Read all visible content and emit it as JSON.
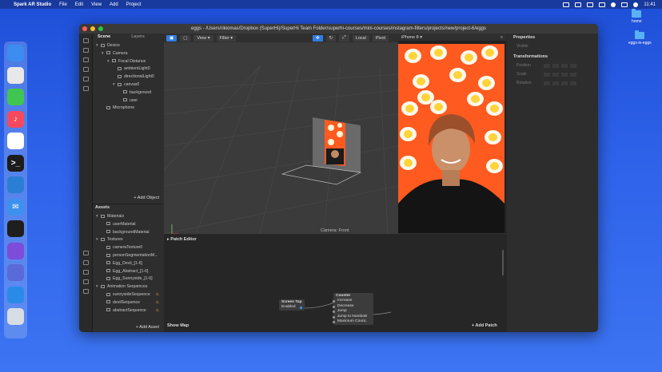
{
  "menubar": {
    "app_name": "Spark AR Studio",
    "menus": [
      "File",
      "Edit",
      "View",
      "Add",
      "Project"
    ],
    "clock": "11:41"
  },
  "desktop": {
    "icons": [
      {
        "label": "home"
      },
      {
        "label": "eggs-is-eggs"
      }
    ]
  },
  "dock": {
    "apps": [
      {
        "name": "finder-icon",
        "color": "#3b8df0",
        "glyph": ""
      },
      {
        "name": "chrome-icon",
        "color": "#e8e8e8",
        "glyph": ""
      },
      {
        "name": "messages-icon",
        "color": "#3fc552",
        "glyph": ""
      },
      {
        "name": "music-icon",
        "color": "#f54a5e",
        "glyph": "♪"
      },
      {
        "name": "slack-icon",
        "color": "#ffffff",
        "glyph": ""
      },
      {
        "name": "terminal-icon",
        "color": "#1c1c1c",
        "glyph": ">_"
      },
      {
        "name": "vscode-icon",
        "color": "#2a7fd4",
        "glyph": ""
      },
      {
        "name": "mail-icon",
        "color": "#3d90ee",
        "glyph": "✉"
      },
      {
        "name": "figma-icon",
        "color": "#1e1e1e",
        "glyph": ""
      },
      {
        "name": "sparkar-icon",
        "color": "#7d4cd8",
        "glyph": ""
      },
      {
        "name": "discord-icon",
        "color": "#5a6ad8",
        "glyph": ""
      },
      {
        "name": "tweetbot-icon",
        "color": "#2a8ae8",
        "glyph": ""
      },
      {
        "name": "trash-icon",
        "color": "#d8dde4",
        "glyph": ""
      }
    ]
  },
  "window": {
    "title": "eggs - /Users/rikiomas/Dropbox (SuperHi)/SuperHi Team Folder/superhi-courses/mini-courses/instagram-filters/projects/new/project-6/eggs"
  },
  "scene": {
    "tabs": [
      "Scene",
      "Layers"
    ],
    "items": [
      {
        "label": "Device",
        "indent": 0,
        "arrow": "▾"
      },
      {
        "label": "Camera",
        "indent": 1,
        "arrow": "▾"
      },
      {
        "label": "Focal Distance",
        "indent": 2,
        "arrow": "▾"
      },
      {
        "label": "ambientLight0",
        "indent": 3,
        "arrow": ""
      },
      {
        "label": "directionalLight0",
        "indent": 3,
        "arrow": ""
      },
      {
        "label": "canvas0",
        "indent": 3,
        "arrow": "▾"
      },
      {
        "label": "background",
        "indent": 4,
        "arrow": ""
      },
      {
        "label": "user",
        "indent": 4,
        "arrow": ""
      },
      {
        "label": "Microphone",
        "indent": 1,
        "arrow": ""
      }
    ],
    "add_object": "+ Add Object"
  },
  "assets": {
    "header": "Assets",
    "items": [
      {
        "label": "Materials",
        "indent": 0,
        "arrow": "▾",
        "warn": ""
      },
      {
        "label": "userMaterial",
        "indent": 1,
        "arrow": "",
        "warn": ""
      },
      {
        "label": "backgroundMaterial",
        "indent": 1,
        "arrow": "",
        "warn": ""
      },
      {
        "label": "Textures",
        "indent": 0,
        "arrow": "▾",
        "warn": ""
      },
      {
        "label": "cameraTexture0",
        "indent": 1,
        "arrow": "",
        "warn": ""
      },
      {
        "label": "personSegmentationM...",
        "indent": 1,
        "arrow": "",
        "warn": ""
      },
      {
        "label": "Egg_Devil_[1-6]",
        "indent": 1,
        "arrow": "",
        "warn": ""
      },
      {
        "label": "Egg_Abstract_[1-6]",
        "indent": 1,
        "arrow": "",
        "warn": ""
      },
      {
        "label": "Egg_Sunnyside_[1-6]",
        "indent": 1,
        "arrow": "",
        "warn": ""
      },
      {
        "label": "Animation Sequences",
        "indent": 0,
        "arrow": "▾",
        "warn": ""
      },
      {
        "label": "sunnysideSequence",
        "indent": 1,
        "arrow": "",
        "warn": "⚠"
      },
      {
        "label": "devilSequence",
        "indent": 1,
        "arrow": "",
        "warn": "⚠"
      },
      {
        "label": "abstractSequence",
        "indent": 1,
        "arrow": "",
        "warn": "⚠"
      }
    ],
    "add_asset": "+ Add Asset"
  },
  "viewport": {
    "tools": {
      "view": "View ▾",
      "filter": "Filter ▾",
      "local": "Local",
      "pivot": "Pivot"
    },
    "camera_label": "Camera: Front"
  },
  "simulator": {
    "device": "iPhone 8 ▾"
  },
  "properties": {
    "header": "Properties",
    "visible_label": "Visible",
    "transformations_header": "Transformations",
    "rows": [
      "Position",
      "Scale",
      "Rotation"
    ]
  },
  "patch_editor": {
    "header": "Patch Editor",
    "show_map": "Show Map",
    "add_patch": "+ Add Patch",
    "screen_tap": {
      "title": "Screen Tap",
      "port": "Enabled"
    },
    "counter": {
      "title": "Counter",
      "rows": [
        {
          "label": "Increase",
          "value": ""
        },
        {
          "label": "Decrease",
          "value": ""
        },
        {
          "label": "Jump",
          "value": ""
        },
        {
          "label": "Jump to Number",
          "value": "0"
        },
        {
          "label": "Maximum Count",
          "value": "..."
        }
      ]
    }
  }
}
